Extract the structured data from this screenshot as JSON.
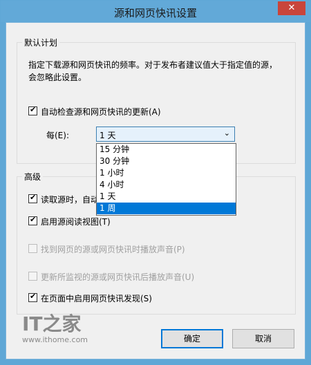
{
  "window": {
    "title": "源和网页快讯设置",
    "close_label": "✕"
  },
  "schedule": {
    "title": "默认计划",
    "description_line1": "指定下载源和网页快讯的频率。对于发布者建议值大于指定值的源，",
    "description_line2": "会忽略此设置。",
    "auto_check_label": "自动检查源和网页快讯的更新(A)",
    "auto_check_checked": true,
    "every_label": "每(E):",
    "selected_value": "1 天",
    "options": [
      "15 分钟",
      "30 分钟",
      "1 小时",
      "4 小时",
      "1 天",
      "1 周"
    ],
    "highlighted_option": "1 周"
  },
  "advanced": {
    "title": "高级",
    "items": [
      {
        "label": "读取源时，自动",
        "checked": true,
        "enabled": true
      },
      {
        "label": "启用源阅读视图(T)",
        "checked": true,
        "enabled": true
      },
      {
        "label": "找到网页的源或网页快讯时播放声音(P)",
        "checked": false,
        "enabled": false
      },
      {
        "label": "更新所监视的源或网页快讯后播放声音(U)",
        "checked": false,
        "enabled": false
      },
      {
        "label": "在页面中启用网页快讯发现(S)",
        "checked": true,
        "enabled": true
      }
    ]
  },
  "buttons": {
    "ok": "确定",
    "cancel": "取消"
  },
  "watermark": {
    "brand": "IT之家",
    "url": "www.ithome.com"
  }
}
